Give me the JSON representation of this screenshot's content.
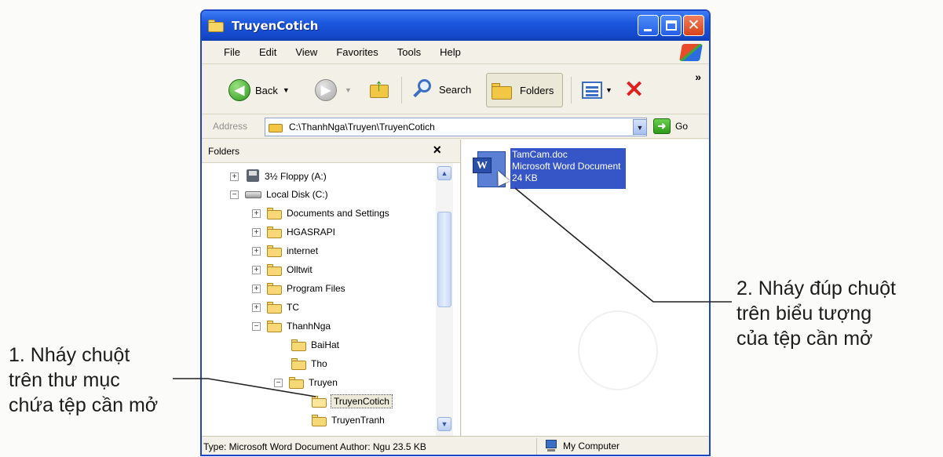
{
  "window": {
    "title": "TruyenCotich"
  },
  "menu": [
    "File",
    "Edit",
    "View",
    "Favorites",
    "Tools",
    "Help"
  ],
  "toolbar": {
    "back_label": "Back",
    "search_label": "Search",
    "folders_label": "Folders",
    "overflow": "»"
  },
  "address": {
    "label": "Address",
    "value": "C:\\ThanhNga\\Truyen\\TruyenCotich",
    "go_label": "Go"
  },
  "folders_pane": {
    "title": "Folders",
    "close": "×",
    "tree": [
      {
        "label": "3½ Floppy (A:)",
        "expander": "+"
      },
      {
        "label": "Local Disk (C:)",
        "expander": "−"
      },
      {
        "label": "Documents and Settings",
        "expander": "+"
      },
      {
        "label": "HGASRAPI",
        "expander": "+"
      },
      {
        "label": "internet",
        "expander": "+"
      },
      {
        "label": "Olltwit",
        "expander": "+"
      },
      {
        "label": "Program Files",
        "expander": "+"
      },
      {
        "label": "TC",
        "expander": "+"
      },
      {
        "label": "ThanhNga",
        "expander": "−"
      },
      {
        "label": "BaiHat",
        "expander": ""
      },
      {
        "label": "Tho",
        "expander": ""
      },
      {
        "label": "Truyen",
        "expander": "−"
      },
      {
        "label": "TruyenCotich",
        "expander": ""
      },
      {
        "label": "TruyenTranh",
        "expander": ""
      }
    ]
  },
  "file": {
    "name": "TamCam.doc",
    "type": "Microsoft Word Document",
    "size": "24 KB"
  },
  "statusbar": {
    "left": "Type: Microsoft Word Document Author: Ngu 23.5 KB",
    "right": "My Computer"
  },
  "annotations": {
    "step1": [
      "1. Nháy chuột",
      "trên thư mục",
      "chứa tệp cần mở"
    ],
    "step2": [
      "2. Nháy đúp chuột",
      "trên biểu tượng",
      "của tệp cần mở"
    ]
  }
}
